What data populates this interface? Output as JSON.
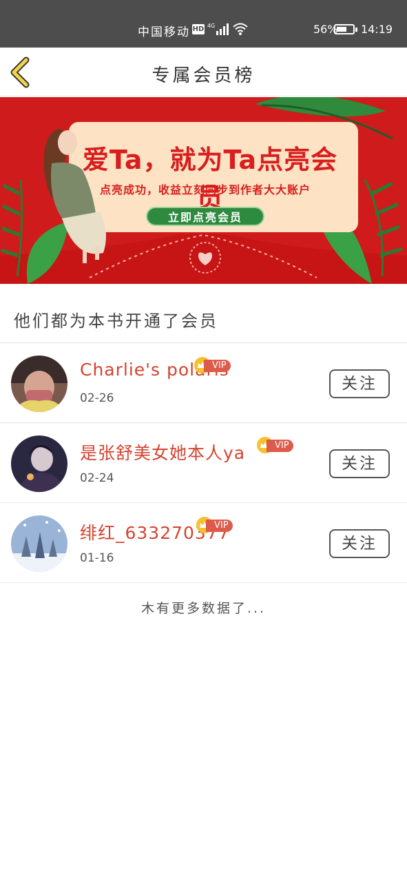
{
  "status_bar": {
    "carrier": "中国移动",
    "hd": "HD",
    "network": "4G",
    "battery": "56%",
    "battery_level": 0.56,
    "time": "14:19"
  },
  "header": {
    "back_icon": "chevron-left-icon",
    "title": "专属会员榜"
  },
  "banner": {
    "title": "爱Ta，就为Ta点亮会员",
    "subtitle": "点亮成功，收益立刻同步到作者大大账户",
    "button_label": "立即点亮会员"
  },
  "section": {
    "heading": "他们都为本书开通了会员"
  },
  "members": [
    {
      "name": "Charlie's polaris",
      "vip": "VIP",
      "date": "02-26",
      "follow": "关注"
    },
    {
      "name": "是张舒美女她本人ya",
      "vip": "VIP",
      "date": "02-24",
      "follow": "关注"
    },
    {
      "name": "绯红_633270377",
      "vip": "VIP",
      "date": "01-16",
      "follow": "关注"
    }
  ],
  "footer": {
    "no_more": "木有更多数据了..."
  },
  "colors": {
    "status_bar_bg": "#4d4d4d",
    "banner_red": "#cf1b1b",
    "name_red": "#d6432f",
    "vip_gold": "#f5c12e",
    "vip_red": "#de5a4a",
    "back_yellow": "#f3d548"
  }
}
